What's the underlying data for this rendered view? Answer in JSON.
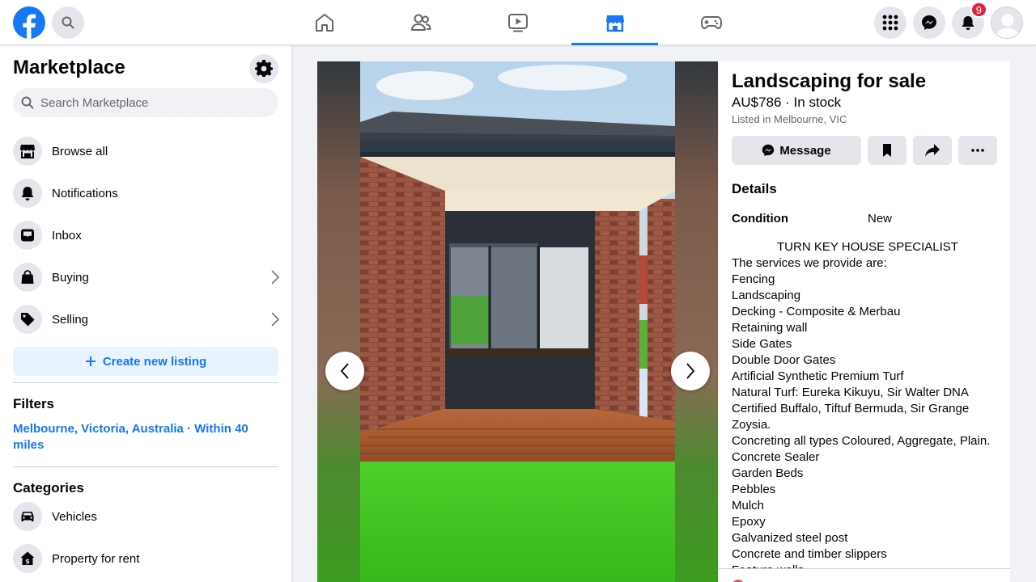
{
  "header": {
    "nav_tabs": [
      {
        "name": "home"
      },
      {
        "name": "friends"
      },
      {
        "name": "watch"
      },
      {
        "name": "marketplace",
        "active": true
      },
      {
        "name": "gaming"
      }
    ],
    "notification_count": "9",
    "brand_color": "#1877f2"
  },
  "sidebar": {
    "title": "Marketplace",
    "search_placeholder": "Search Marketplace",
    "items": [
      {
        "label": "Browse all",
        "icon": "storefront-icon"
      },
      {
        "label": "Notifications",
        "icon": "bell-icon"
      },
      {
        "label": "Inbox",
        "icon": "inbox-icon"
      },
      {
        "label": "Buying",
        "icon": "shopping-bag-icon"
      },
      {
        "label": "Selling",
        "icon": "price-tag-icon"
      }
    ],
    "create_label": "Create new listing",
    "filters_title": "Filters",
    "filter_location": "Melbourne, Victoria, Australia · Within 40 miles",
    "categories_title": "Categories",
    "categories": [
      {
        "label": "Vehicles",
        "icon": "car-icon"
      },
      {
        "label": "Property for rent",
        "icon": "house-dollar-icon"
      }
    ]
  },
  "listing": {
    "title": "Landscaping for sale",
    "price_stock": "AU$786 · In stock",
    "location": "Listed in Melbourne, VIC",
    "message_label": "Message",
    "details_title": "Details",
    "condition_label": "Condition",
    "condition_value": "New",
    "description_heading": "TURN KEY HOUSE SPECIALIST",
    "description_lines": [
      "The services we provide are:",
      "Fencing",
      "Landscaping",
      "Decking - Composite & Merbau",
      "Retaining wall",
      "Side Gates",
      "Double Door Gates",
      "Artificial Synthetic Premium Turf",
      "Natural Turf: Eureka Kikuyu, Sir Walter DNA Certified Buffalo, Tiftuf Bermuda, Sir Grange Zoysia.",
      "Concreting all types Coloured, Aggregate, Plain.",
      "Concrete Sealer",
      "Garden Beds",
      "Pebbles",
      "Mulch",
      "Epoxy",
      "Galvanized steel post",
      "Concrete and timber slippers",
      "Feature walls"
    ]
  }
}
